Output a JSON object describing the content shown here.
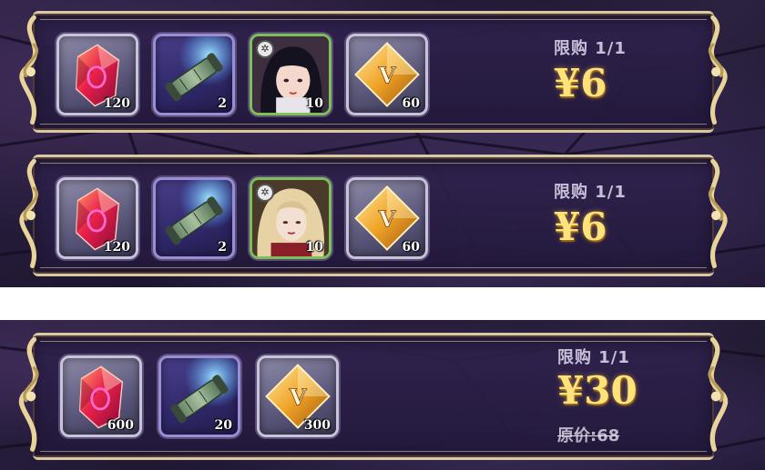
{
  "offers": [
    {
      "items": [
        {
          "type": "red-gem-icon",
          "qty": "120"
        },
        {
          "type": "scroll-icon",
          "qty": "2"
        },
        {
          "type": "hero-portrait-dark-hair",
          "qty": "10"
        },
        {
          "type": "gold-crystal-icon",
          "qty": "60"
        }
      ],
      "limit": "限购 1/1",
      "price": "¥6"
    },
    {
      "items": [
        {
          "type": "red-gem-icon",
          "qty": "120"
        },
        {
          "type": "scroll-icon",
          "qty": "2"
        },
        {
          "type": "hero-portrait-blonde-hair",
          "qty": "10"
        },
        {
          "type": "gold-crystal-icon",
          "qty": "60"
        }
      ],
      "limit": "限购 1/1",
      "price": "¥6"
    },
    {
      "items": [
        {
          "type": "red-gem-icon",
          "qty": "600"
        },
        {
          "type": "scroll-icon",
          "qty": "20"
        },
        {
          "type": "gold-crystal-icon",
          "qty": "300"
        }
      ],
      "limit": "限购 1/1",
      "price": "¥30",
      "original_price": "原价:68"
    }
  ],
  "colors": {
    "price_gold": "#ffe27a",
    "frame_cream": "#d9c9a0",
    "panel_purple": "#2a2040"
  }
}
